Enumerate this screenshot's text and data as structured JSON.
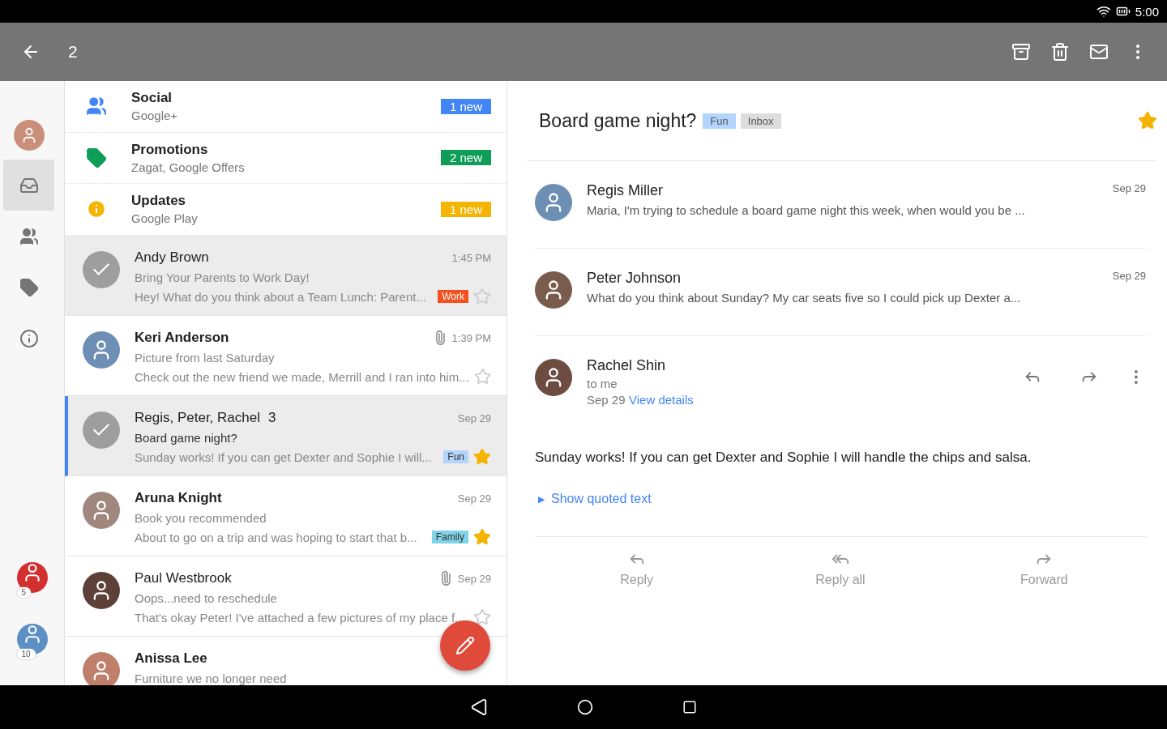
{
  "status_bar": {
    "time": "5:00"
  },
  "toolbar": {
    "selected_count": "2"
  },
  "rail": {
    "items": [
      {
        "kind": "account",
        "selected": false
      },
      {
        "kind": "inbox",
        "selected": true
      },
      {
        "kind": "people",
        "selected": false
      },
      {
        "kind": "labels",
        "selected": false
      },
      {
        "kind": "info",
        "selected": false
      }
    ],
    "accounts": [
      {
        "badge": "5",
        "color": "#d32f2f"
      },
      {
        "badge": "10",
        "color": "#5c8fc4"
      }
    ]
  },
  "categories": [
    {
      "kind": "social",
      "name": "Social",
      "sub": "Google+",
      "badge": "1 new",
      "color": "#4285f4"
    },
    {
      "kind": "promotions",
      "name": "Promotions",
      "sub": "Zagat, Google Offers",
      "badge": "2 new",
      "color": "#0f9d58"
    },
    {
      "kind": "updates",
      "name": "Updates",
      "sub": "Google Play",
      "badge": "1 new",
      "color": "#f4b400"
    }
  ],
  "conversations": [
    {
      "sender": "Andy Brown",
      "time": "1:45 PM",
      "subject": "Bring Your Parents to Work Day!",
      "snippet": "Hey! What do you think about a Team Lunch: Parent...",
      "label": {
        "text": "Work",
        "color": "#f4511e"
      },
      "starred": false,
      "checked": true,
      "unread": false,
      "open": false,
      "attachment": false
    },
    {
      "sender": "Keri Anderson",
      "time": "1:39 PM",
      "subject": "Picture from last Saturday",
      "snippet": "Check out the new friend we made, Merrill and I ran into him...",
      "starred": false,
      "checked": false,
      "unread": true,
      "open": false,
      "attachment": true
    },
    {
      "sender": "Regis, Peter, Rachel",
      "count": "3",
      "time": "Sep 29",
      "subject": "Board game night?",
      "snippet": "Sunday works! If you can get Dexter and Sophie I will...",
      "label": {
        "text": "Fun",
        "color": "#b3d4fc"
      },
      "starred": true,
      "checked": true,
      "unread": false,
      "open": true,
      "attachment": false
    },
    {
      "sender": "Aruna Knight",
      "time": "Sep 29",
      "subject": "Book you recommended",
      "snippet": "About to go on a trip and was hoping to start that b...",
      "label": {
        "text": "Family",
        "color": "#80d4e8"
      },
      "starred": true,
      "checked": false,
      "unread": true,
      "open": false,
      "attachment": false
    },
    {
      "sender": "Paul Westbrook",
      "time": "Sep 29",
      "subject": "Oops...need to reschedule",
      "snippet": "That's okay Peter! I've attached a few pictures of my place f...",
      "starred": false,
      "checked": false,
      "unread": false,
      "open": false,
      "attachment": true
    },
    {
      "sender": "Anissa Lee",
      "subject": "Furniture we no longer need",
      "checked": false,
      "unread": true,
      "open": false,
      "attachment": false
    }
  ],
  "thread": {
    "subject": "Board game night?",
    "labels": [
      {
        "text": "Fun",
        "color": "#b3d4fc"
      },
      {
        "text": "Inbox",
        "color": "#dddddd"
      }
    ],
    "starred": true,
    "collapsed": [
      {
        "sender": "Regis Miller",
        "date": "Sep 29",
        "snippet": "Maria, I'm trying to schedule a board game night this week, when would you be ..."
      },
      {
        "sender": "Peter Johnson",
        "date": "Sep 29",
        "snippet": "What do you think about Sunday? My car seats five so I could pick up Dexter a..."
      }
    ],
    "expanded": {
      "sender": "Rachel Shin",
      "to": "to me",
      "date": "Sep 29",
      "details_link": "View details",
      "body": "Sunday works! If you can get Dexter and Sophie I will handle the chips and salsa.",
      "quoted_arrow": "▶",
      "quoted_link": "Show quoted text"
    },
    "actions": [
      {
        "kind": "reply",
        "label": "Reply"
      },
      {
        "kind": "reply_all",
        "label": "Reply all"
      },
      {
        "kind": "forward",
        "label": "Forward"
      }
    ]
  }
}
